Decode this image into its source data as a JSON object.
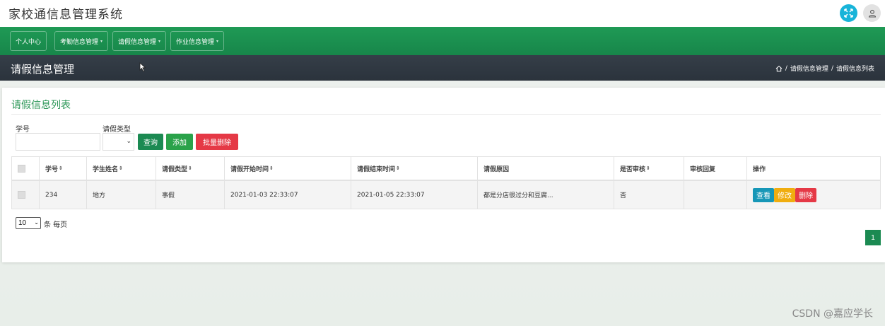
{
  "app": {
    "title": "家校通信息管理系统"
  },
  "nav": {
    "items": [
      {
        "label": "个人中心"
      },
      {
        "label": "考勤信息管理"
      },
      {
        "label": "请假信息管理"
      },
      {
        "label": "作业信息管理"
      }
    ]
  },
  "page": {
    "title": "请假信息管理",
    "breadcrumb": [
      "请假信息管理",
      "请假信息列表"
    ],
    "breadcrumb_sep": "/"
  },
  "card": {
    "title": "请假信息列表"
  },
  "filters": {
    "student_id_label": "学号",
    "leave_type_label": "请假类型",
    "student_id_value": "",
    "leave_type_value": ""
  },
  "buttons": {
    "query": "查询",
    "add": "添加",
    "batch_delete": "批量删除"
  },
  "table": {
    "columns": [
      "学号",
      "学生姓名",
      "请假类型",
      "请假开始时间",
      "请假结束时间",
      "请假原因",
      "是否审核",
      "审核回复",
      "操作"
    ],
    "rows": [
      {
        "student_id": "234",
        "name": "地方",
        "leave_type": "事假",
        "start": "2021-01-03 22:33:07",
        "end": "2021-01-05 22:33:07",
        "reason": "都是分店很过分和豆腐...",
        "reviewed": "否",
        "reply": "",
        "actions": {
          "view": "查看",
          "edit": "修改",
          "delete": "删除"
        }
      }
    ]
  },
  "pagination": {
    "page_size": "10",
    "page_size_label": "条 每页",
    "current_page": "1"
  },
  "watermark": "CSDN @嘉应学长",
  "colors": {
    "nav_green": "#1f9a55",
    "header_dark": "#353e48",
    "accent_green": "#2a9656",
    "danger": "#e53946",
    "info": "#1797b7",
    "warning": "#f0ad0f"
  }
}
